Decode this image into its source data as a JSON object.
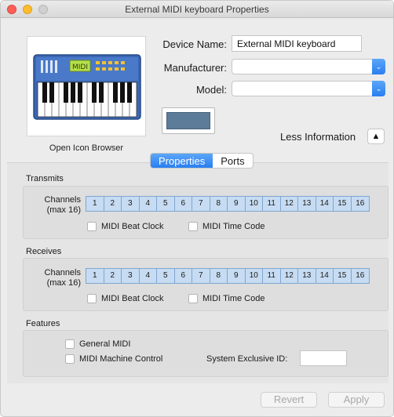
{
  "window": {
    "title": "External MIDI keyboard Properties",
    "accent_color": "#2a7ff0"
  },
  "icon": {
    "name": "midi-keyboard-icon",
    "caption": "Open Icon Browser",
    "display_text": "MIDI"
  },
  "fields": {
    "device_name_label": "Device Name:",
    "device_name_value": "External MIDI keyboard",
    "manufacturer_label": "Manufacturer:",
    "manufacturer_value": "",
    "model_label": "Model:",
    "model_value": "",
    "color_swatch": "#5d7c99"
  },
  "less_info": {
    "label": "Less Information",
    "icon": "triangle-up-icon",
    "glyph": "▲"
  },
  "tabs": [
    {
      "label": "Properties",
      "active": true
    },
    {
      "label": "Ports",
      "active": false
    }
  ],
  "transmits": {
    "header": "Transmits",
    "channels_label_1": "Channels",
    "channels_label_2": "(max 16)",
    "channels": [
      "1",
      "2",
      "3",
      "4",
      "5",
      "6",
      "7",
      "8",
      "9",
      "10",
      "11",
      "12",
      "13",
      "14",
      "15",
      "16"
    ],
    "beat_clock": "MIDI Beat Clock",
    "time_code": "MIDI Time Code"
  },
  "receives": {
    "header": "Receives",
    "channels_label_1": "Channels",
    "channels_label_2": "(max 16)",
    "channels": [
      "1",
      "2",
      "3",
      "4",
      "5",
      "6",
      "7",
      "8",
      "9",
      "10",
      "11",
      "12",
      "13",
      "14",
      "15",
      "16"
    ],
    "beat_clock": "MIDI Beat Clock",
    "time_code": "MIDI Time Code"
  },
  "features": {
    "header": "Features",
    "general_midi": "General MIDI",
    "machine_control": "MIDI Machine Control",
    "sysex_label": "System Exclusive ID:",
    "sysex_value": ""
  },
  "buttons": {
    "revert": "Revert",
    "apply": "Apply"
  },
  "popup_arrow_glyph": "⌄"
}
